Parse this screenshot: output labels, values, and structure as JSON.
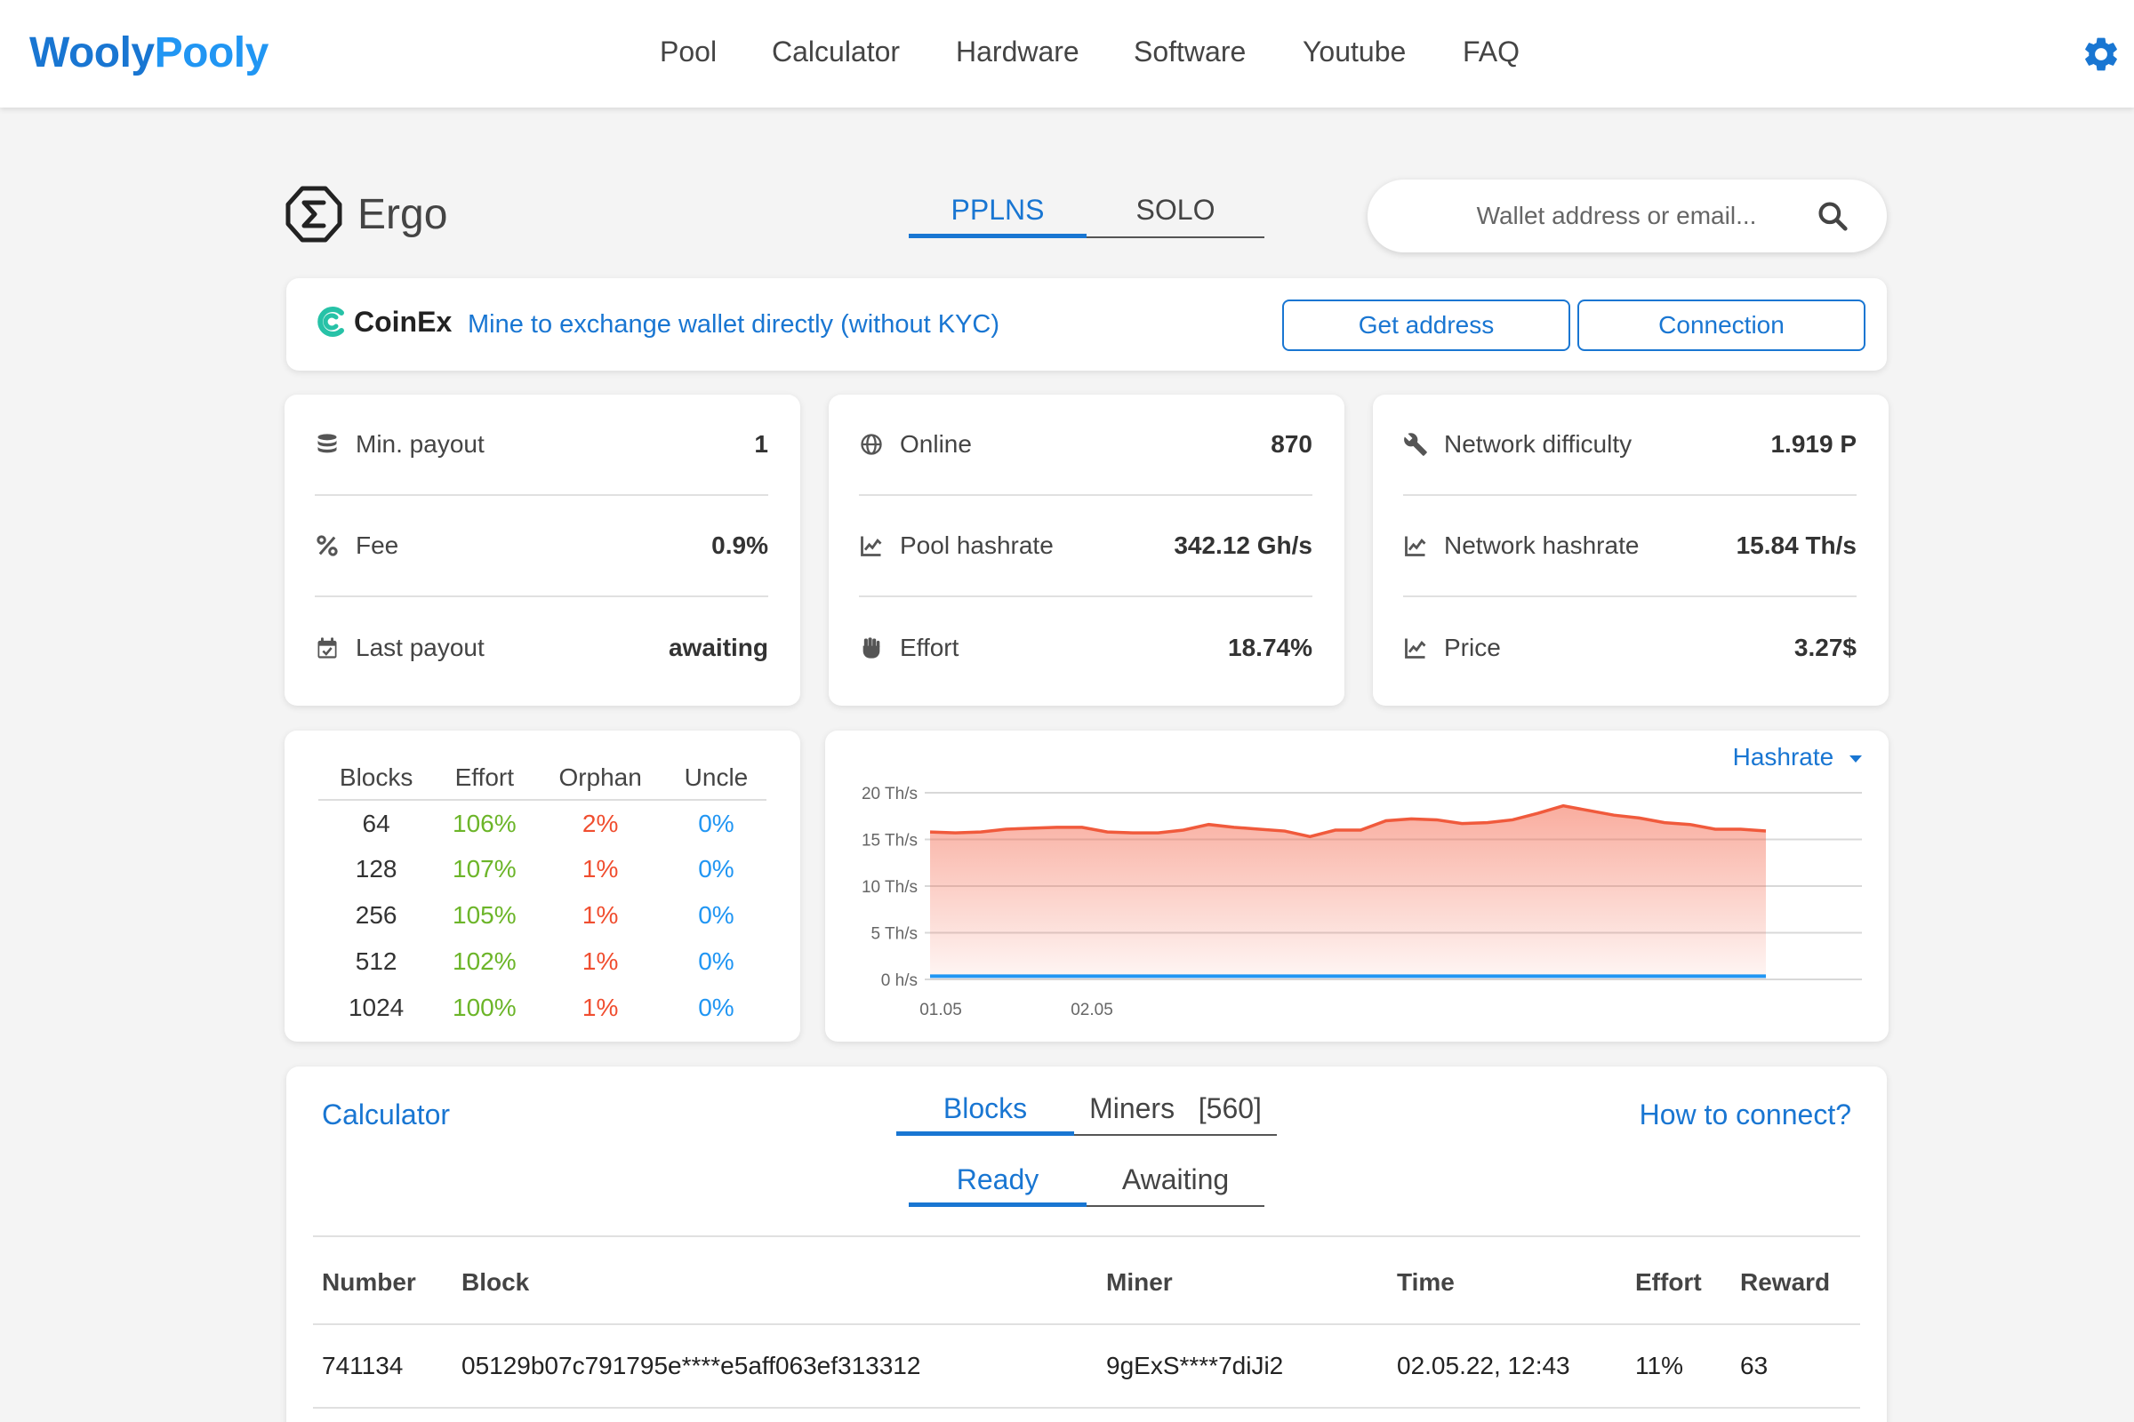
{
  "header": {
    "logo_part1": "Wooly",
    "logo_part2": "Pooly",
    "nav": [
      "Pool",
      "Calculator",
      "Hardware",
      "Software",
      "Youtube",
      "FAQ"
    ]
  },
  "coin": {
    "name": "Ergo",
    "modes": [
      "PPLNS",
      "SOLO"
    ],
    "active_mode": "PPLNS"
  },
  "search": {
    "placeholder": "Wallet address or email..."
  },
  "coinex": {
    "brand": "CoinEx",
    "message": "Mine to exchange wallet directly (without KYC)",
    "get_address": "Get address",
    "connection": "Connection"
  },
  "stats": {
    "card1": [
      {
        "icon": "coins-icon",
        "label": "Min. payout",
        "value": "1"
      },
      {
        "icon": "percent-icon",
        "label": "Fee",
        "value": "0.9%"
      },
      {
        "icon": "calendar-check-icon",
        "label": "Last payout",
        "value": "awaiting"
      }
    ],
    "card2": [
      {
        "icon": "globe-icon",
        "label": "Online",
        "value": "870"
      },
      {
        "icon": "chart-line-icon",
        "label": "Pool hashrate",
        "value": "342.12 Gh/s"
      },
      {
        "icon": "fist-icon",
        "label": "Effort",
        "value": "18.74%"
      }
    ],
    "card3": [
      {
        "icon": "wrench-icon",
        "label": "Network difficulty",
        "value": "1.919 P"
      },
      {
        "icon": "chart-line-icon",
        "label": "Network hashrate",
        "value": "15.84 Th/s"
      },
      {
        "icon": "chart-line-icon",
        "label": "Price",
        "value": "3.27$"
      }
    ]
  },
  "blocks_table": {
    "headers": [
      "Blocks",
      "Effort",
      "Orphan",
      "Uncle"
    ],
    "rows": [
      [
        "64",
        "106%",
        "2%",
        "0%"
      ],
      [
        "128",
        "107%",
        "1%",
        "0%"
      ],
      [
        "256",
        "105%",
        "1%",
        "0%"
      ],
      [
        "512",
        "102%",
        "1%",
        "0%"
      ],
      [
        "1024",
        "100%",
        "1%",
        "0%"
      ]
    ]
  },
  "chart_data": {
    "type": "area",
    "dropdown_label": "Hashrate",
    "y_ticks": [
      "20 Th/s",
      "15 Th/s",
      "10 Th/s",
      "5 Th/s",
      "0 h/s"
    ],
    "x_ticks": [
      "01.05",
      "02.05"
    ],
    "ylim": [
      0,
      20
    ],
    "series": [
      {
        "color": "#f05a3c",
        "values": [
          15.8,
          15.7,
          15.8,
          16.1,
          16.2,
          16.3,
          16.3,
          15.8,
          15.7,
          15.7,
          16.0,
          16.6,
          16.3,
          16.1,
          15.9,
          15.3,
          16.0,
          16.0,
          17.0,
          17.2,
          17.1,
          16.7,
          16.8,
          17.1,
          17.8,
          18.6,
          18.1,
          17.6,
          17.3,
          16.8,
          16.6,
          16.1,
          16.1,
          15.9
        ]
      },
      {
        "color": "#2196f3",
        "values": [
          0.34,
          0.34,
          0.34,
          0.34,
          0.34,
          0.34,
          0.34,
          0.34,
          0.34,
          0.34,
          0.34,
          0.34,
          0.34,
          0.34,
          0.34,
          0.34,
          0.34,
          0.34,
          0.34,
          0.34,
          0.34,
          0.34,
          0.34,
          0.34,
          0.34,
          0.34,
          0.34,
          0.34,
          0.34,
          0.34,
          0.34,
          0.34,
          0.34,
          0.34
        ]
      }
    ]
  },
  "bottom": {
    "calculator": "Calculator",
    "how_to_connect": "How to connect?",
    "tab_blocks": "Blocks",
    "tab_miners": "Miners   [560]",
    "sub_ready": "Ready",
    "sub_awaiting": "Awaiting",
    "columns": [
      "Number",
      "Block",
      "Miner",
      "Time",
      "Effort",
      "Reward"
    ],
    "rows": [
      [
        "741134",
        "05129b07c791795e****e5aff063ef313312",
        "9gExS****7diJi2",
        "02.05.22, 12:43",
        "11%",
        "63"
      ]
    ]
  },
  "colors": {
    "accent": "#1976d2",
    "green": "#6cb529",
    "red": "#f04e30",
    "blue": "#2196f3"
  }
}
